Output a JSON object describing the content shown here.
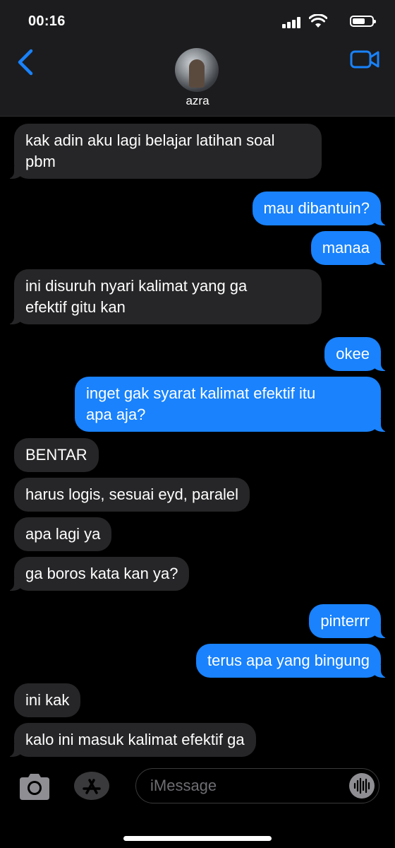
{
  "status_bar": {
    "time": "00:16"
  },
  "header": {
    "contact_name": "azra"
  },
  "messages": [
    {
      "side": "in",
      "text": "kak adin aku lagi belajar latihan soal\npbm"
    },
    {
      "side": "out",
      "text": "mau dibantuin?"
    },
    {
      "side": "out",
      "text": "manaa"
    },
    {
      "side": "in",
      "text": "ini disuruh nyari kalimat yang ga\nefektif gitu kan"
    },
    {
      "side": "out",
      "text": "okee"
    },
    {
      "side": "out",
      "text": "inget gak syarat kalimat efektif itu\napa aja?"
    },
    {
      "side": "in",
      "text": "BENTAR"
    },
    {
      "side": "in",
      "text": "harus logis, sesuai eyd, paralel"
    },
    {
      "side": "in",
      "text": "apa lagi ya"
    },
    {
      "side": "in",
      "text": "ga boros kata kan ya?"
    },
    {
      "side": "out",
      "text": "pinterrr"
    },
    {
      "side": "out",
      "text": "terus apa yang bingung"
    },
    {
      "side": "in",
      "text": "ini kak"
    },
    {
      "side": "in",
      "text": "kalo ini masuk kalimat efektif ga"
    }
  ],
  "input": {
    "placeholder": "iMessage"
  },
  "colors": {
    "outgoing": "#1982fc",
    "incoming": "#262628",
    "accent": "#1982fc"
  },
  "icons": [
    "back-chevron-icon",
    "video-camera-icon",
    "camera-icon",
    "app-store-icon",
    "audio-waveform-icon"
  ]
}
